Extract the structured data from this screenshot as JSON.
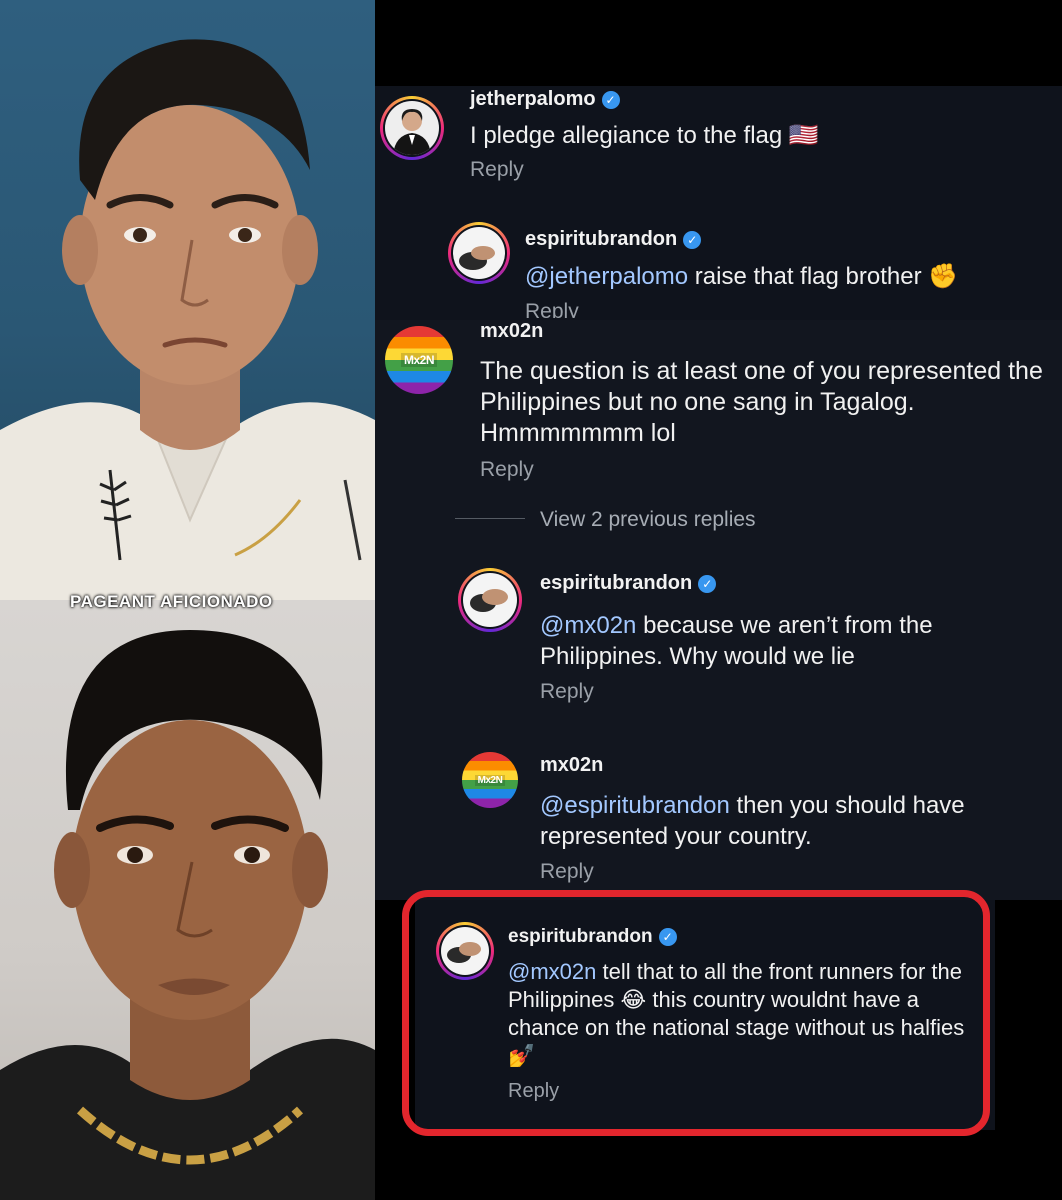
{
  "watermark": "PAGEANT AFICIONADO",
  "colors": {
    "highlight": "#e3262d",
    "verified": "#3897f0",
    "mention": "#a3c8ff",
    "panel": "#0f131c"
  },
  "icons": {
    "verified": "verified-badge-icon",
    "flag": "us-flag-emoji",
    "fist": "raised-fist-emoji",
    "laugh": "laughing-emoji",
    "nails": "nail-polish-emoji"
  },
  "comments": [
    {
      "username": "jetherpalomo",
      "text": "I pledge allegiance to the flag",
      "emoji": "🇺🇸",
      "reply": "Reply"
    },
    {
      "username": "espiritubrandon",
      "mention": "@jetherpalomo",
      "text": " raise that flag brother ",
      "emoji": "✊",
      "reply": "Reply"
    },
    {
      "username": "mx02n",
      "avatar_text": "Mx2N",
      "text": "The question is at least one of you represented the Philippines but no one sang in Tagalog. Hmmmmmmm lol",
      "reply": "Reply"
    },
    {
      "username": "espiritubrandon",
      "mention": "@mx02n",
      "text": " because we aren’t from the Philippines. Why would we lie",
      "reply": "Reply"
    },
    {
      "username": "mx02n",
      "avatar_text": "Mx2N",
      "mention": "@espiritubrandon",
      "text": " then you should have represented your country.",
      "reply": "Reply"
    },
    {
      "username": "espiritubrandon",
      "mention": "@mx02n",
      "text_a": " tell that to all the front runners for the Philippines ",
      "emoji_a": "😂",
      "text_b": " this country wouldnt have a chance on the national stage without us halfies ",
      "emoji_b": "💅",
      "reply": "Reply"
    }
  ],
  "view_previous": "View 2 previous replies"
}
